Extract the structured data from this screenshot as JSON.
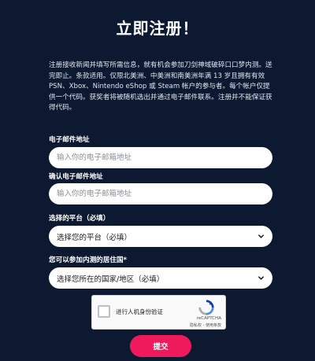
{
  "page": {
    "title": "立即注册！",
    "description": "注册接收新闻并填写所需信息，就有机会参加刀剑神域破碎口口梦内测。送完即止。条款适用。仅限北美洲、中美洲和南美洲年满 13 岁且拥有有效 PSN、Xbox、Nintendo eShop 或 Steam 帐户的参与者。每个帐户仅提供一个代码。获奖者将被随机选出并通过电子邮件联系。注册并不能保证获得代码。"
  },
  "form": {
    "email_label": "电子邮件地址",
    "email_placeholder": "输入你的电子邮箱地址",
    "confirm_label": "确认电子邮件地址",
    "confirm_placeholder": "输入你的电子邮箱地址",
    "platform_label": "选择的平台（必填）",
    "platform_selected": "选择您的平台（必填）",
    "country_label": "您可以参加内测的居住国*",
    "country_selected": "选择您所在的国家/地区（必填）",
    "submit_label": "提交"
  },
  "captcha": {
    "text": "进行人机身份验证",
    "brand": "reCAPTCHA",
    "links": "隐私权 - 使用条款"
  },
  "colors": {
    "background": "#0c1930",
    "accent": "#ee1a5b"
  },
  "icons": {
    "select_chevron": "chevron-down-icon",
    "captcha_logo": "recaptcha-logo"
  }
}
